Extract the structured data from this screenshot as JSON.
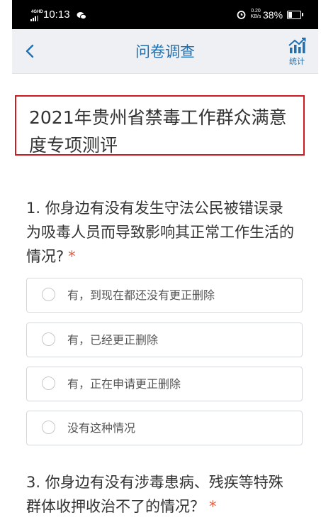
{
  "status_bar": {
    "network": "4GHD",
    "time": "10:13",
    "speed_value": "0.20",
    "speed_unit": "KB/s",
    "battery": "38%"
  },
  "nav": {
    "title": "问卷调查",
    "stats_label": "统计"
  },
  "survey": {
    "title": "2021年贵州省禁毒工作群众满意度专项测评",
    "required_mark": "*",
    "questions": [
      {
        "text": "1. 你身边有没有发生守法公民被错误录为吸毒人员而导致影响其正常工作生活的情况?",
        "options": [
          "有，到现在都还没有更正删除",
          "有，已经更正删除",
          "有，正在申请更正删除",
          "没有这种情况"
        ]
      },
      {
        "text": "3. 你身边有没有涉毒患病、残疾等特殊群体收押收治不了的情况？"
      }
    ]
  },
  "colors": {
    "accent": "#1f6fb1",
    "highlight_border": "#d01a20",
    "required": "#e85c40"
  }
}
